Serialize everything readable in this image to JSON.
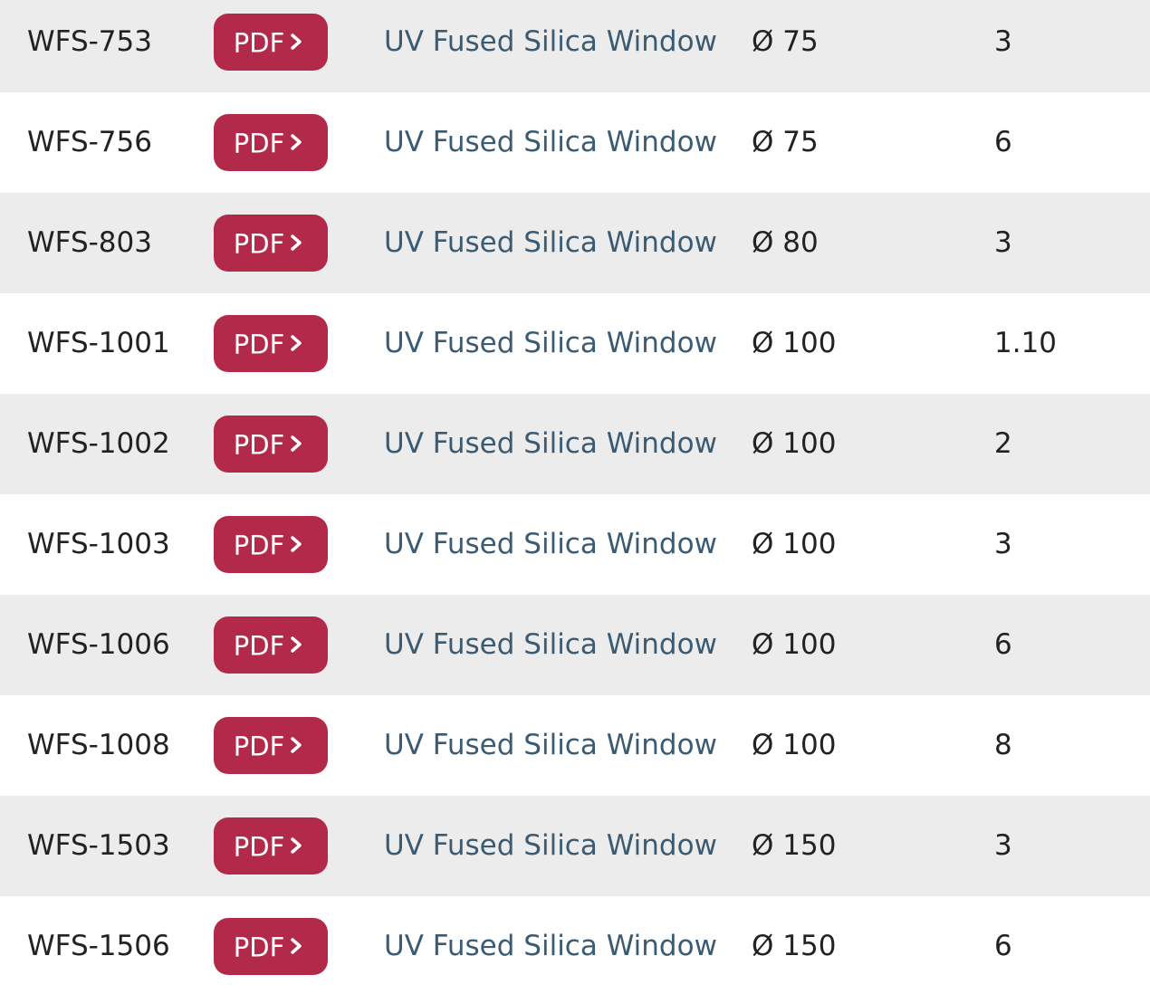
{
  "colors": {
    "row_alt": "#ececec",
    "row_plain": "#ffffff",
    "pdf_button": "#b3294a",
    "link": "#3b5b72",
    "text": "#222222"
  },
  "pdf_icon": "chevron-right-icon",
  "rows": [
    {
      "part": "WFS-753",
      "pdf": "PDF",
      "description": "UV Fused Silica Window",
      "diameter": "Ø 75",
      "thickness": "3"
    },
    {
      "part": "WFS-756",
      "pdf": "PDF",
      "description": "UV Fused Silica Window",
      "diameter": "Ø 75",
      "thickness": "6"
    },
    {
      "part": "WFS-803",
      "pdf": "PDF",
      "description": "UV Fused Silica Window",
      "diameter": "Ø 80",
      "thickness": "3"
    },
    {
      "part": "WFS-1001",
      "pdf": "PDF",
      "description": "UV Fused Silica Window",
      "diameter": "Ø 100",
      "thickness": "1.10"
    },
    {
      "part": "WFS-1002",
      "pdf": "PDF",
      "description": "UV Fused Silica Window",
      "diameter": "Ø 100",
      "thickness": "2"
    },
    {
      "part": "WFS-1003",
      "pdf": "PDF",
      "description": "UV Fused Silica Window",
      "diameter": "Ø 100",
      "thickness": "3"
    },
    {
      "part": "WFS-1006",
      "pdf": "PDF",
      "description": "UV Fused Silica Window",
      "diameter": "Ø 100",
      "thickness": "6"
    },
    {
      "part": "WFS-1008",
      "pdf": "PDF",
      "description": "UV Fused Silica Window",
      "diameter": "Ø 100",
      "thickness": "8"
    },
    {
      "part": "WFS-1503",
      "pdf": "PDF",
      "description": "UV Fused Silica Window",
      "diameter": "Ø 150",
      "thickness": "3"
    },
    {
      "part": "WFS-1506",
      "pdf": "PDF",
      "description": "UV Fused Silica Window",
      "diameter": "Ø 150",
      "thickness": "6"
    }
  ]
}
